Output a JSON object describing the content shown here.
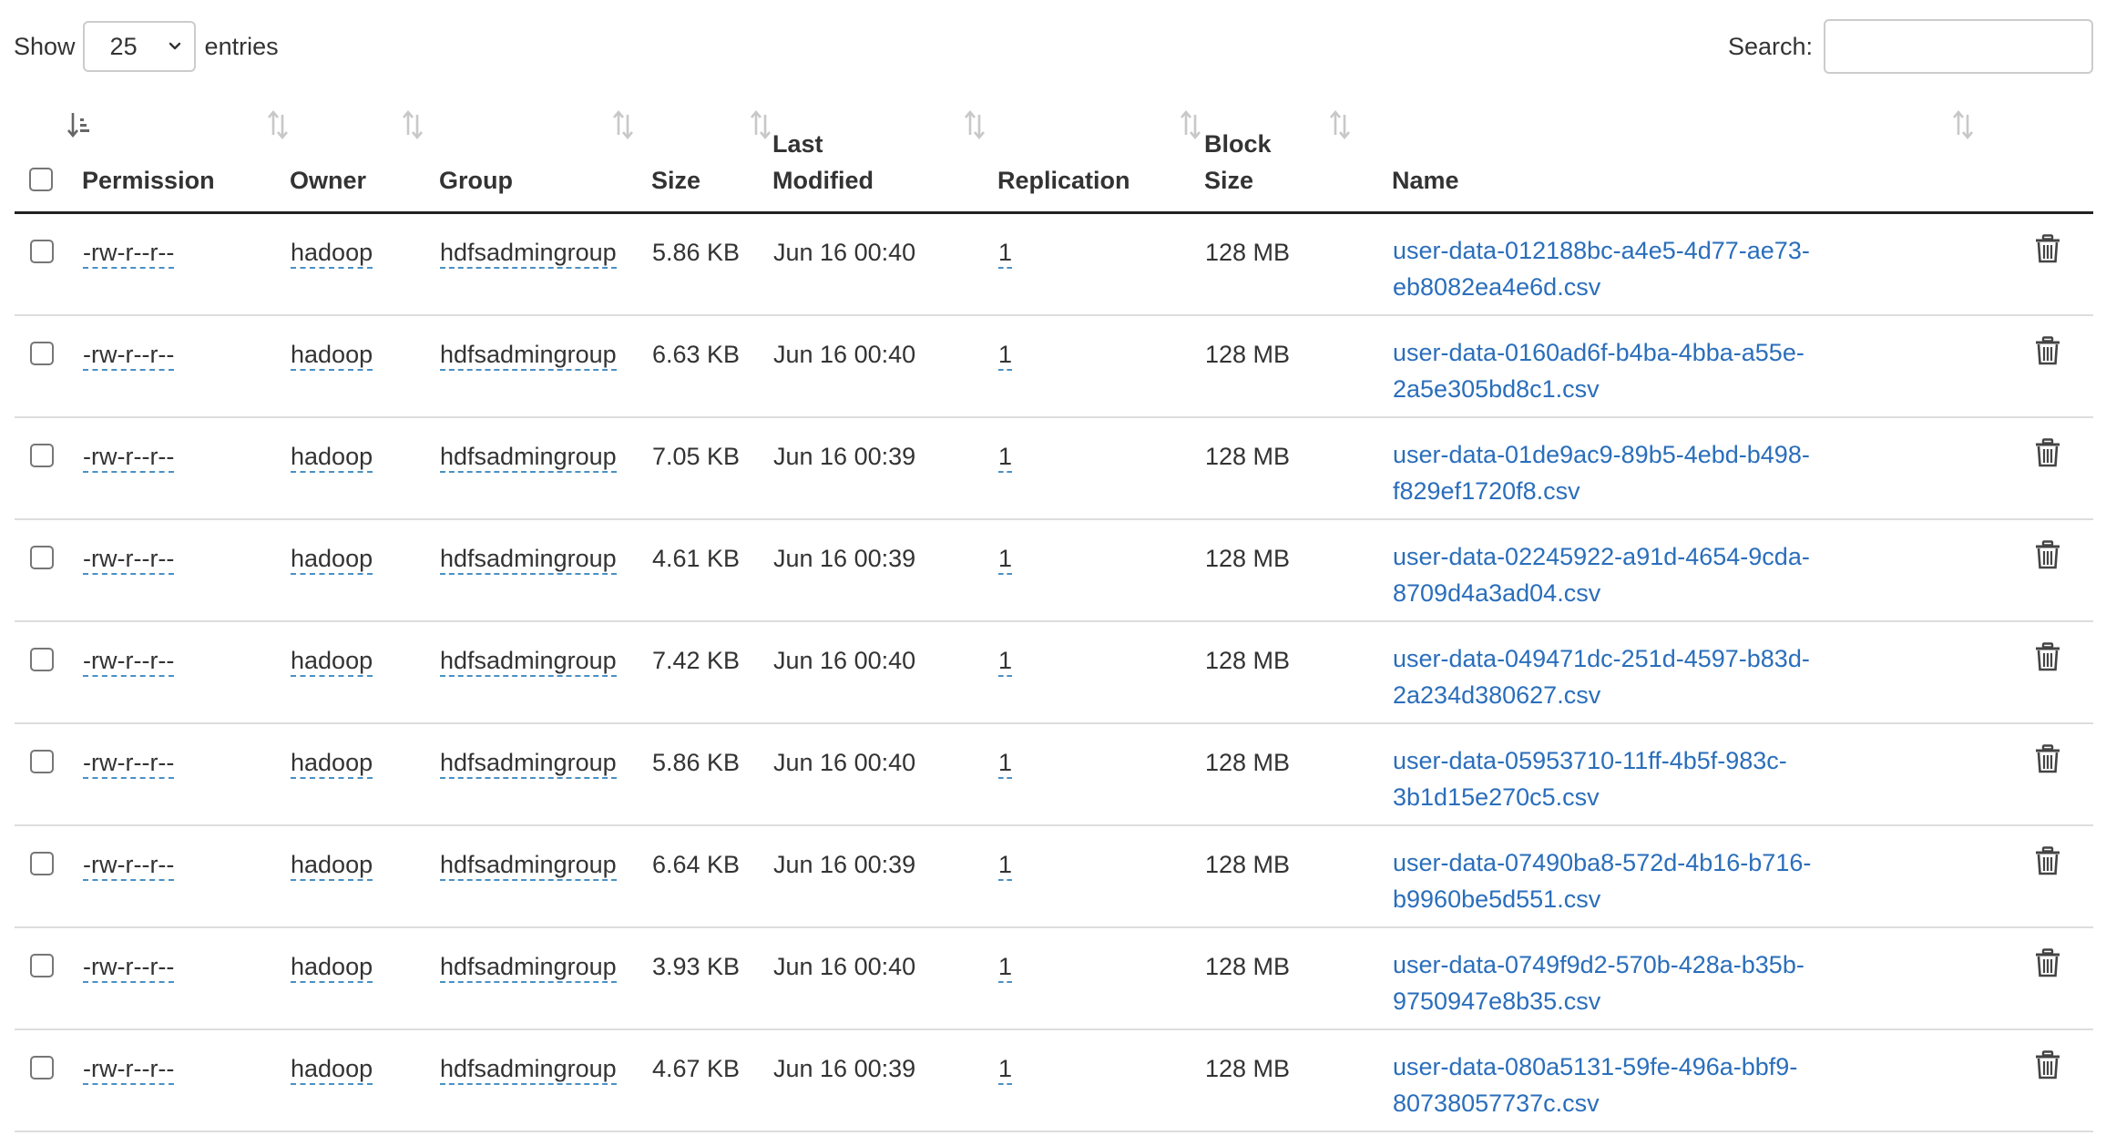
{
  "length_menu": {
    "show_label": "Show",
    "selected": "25",
    "entries_label": "entries"
  },
  "search": {
    "label": "Search:",
    "value": "",
    "placeholder": ""
  },
  "table": {
    "columns": [
      "",
      "Permission",
      "Owner",
      "Group",
      "Size",
      "Last Modified",
      "Replication",
      "Block Size",
      "Name",
      ""
    ],
    "header": {
      "permission": "Permission",
      "owner": "Owner",
      "group": "Group",
      "size": "Size",
      "last_modified_1": "Last",
      "last_modified_2": "Modified",
      "replication": "Replication",
      "block_size_1": "Block",
      "block_size_2": "Size",
      "name": "Name"
    },
    "rows": [
      {
        "permission": "-rw-r--r--",
        "owner": "hadoop",
        "group": "hdfsadmingroup",
        "size": "5.86 KB",
        "modified": "Jun 16 00:40",
        "replication": "1",
        "block_size": "128 MB",
        "name_1": "user-data-012188bc-a4e5-4d77-ae73-",
        "name_2": "eb8082ea4e6d.csv"
      },
      {
        "permission": "-rw-r--r--",
        "owner": "hadoop",
        "group": "hdfsadmingroup",
        "size": "6.63 KB",
        "modified": "Jun 16 00:40",
        "replication": "1",
        "block_size": "128 MB",
        "name_1": "user-data-0160ad6f-b4ba-4bba-a55e-",
        "name_2": "2a5e305bd8c1.csv"
      },
      {
        "permission": "-rw-r--r--",
        "owner": "hadoop",
        "group": "hdfsadmingroup",
        "size": "7.05 KB",
        "modified": "Jun 16 00:39",
        "replication": "1",
        "block_size": "128 MB",
        "name_1": "user-data-01de9ac9-89b5-4ebd-b498-",
        "name_2": "f829ef1720f8.csv"
      },
      {
        "permission": "-rw-r--r--",
        "owner": "hadoop",
        "group": "hdfsadmingroup",
        "size": "4.61 KB",
        "modified": "Jun 16 00:39",
        "replication": "1",
        "block_size": "128 MB",
        "name_1": "user-data-02245922-a91d-4654-9cda-",
        "name_2": "8709d4a3ad04.csv"
      },
      {
        "permission": "-rw-r--r--",
        "owner": "hadoop",
        "group": "hdfsadmingroup",
        "size": "7.42 KB",
        "modified": "Jun 16 00:40",
        "replication": "1",
        "block_size": "128 MB",
        "name_1": "user-data-049471dc-251d-4597-b83d-",
        "name_2": "2a234d380627.csv"
      },
      {
        "permission": "-rw-r--r--",
        "owner": "hadoop",
        "group": "hdfsadmingroup",
        "size": "5.86 KB",
        "modified": "Jun 16 00:40",
        "replication": "1",
        "block_size": "128 MB",
        "name_1": "user-data-05953710-11ff-4b5f-983c-",
        "name_2": "3b1d15e270c5.csv"
      },
      {
        "permission": "-rw-r--r--",
        "owner": "hadoop",
        "group": "hdfsadmingroup",
        "size": "6.64 KB",
        "modified": "Jun 16 00:39",
        "replication": "1",
        "block_size": "128 MB",
        "name_1": "user-data-07490ba8-572d-4b16-b716-",
        "name_2": "b9960be5d551.csv"
      },
      {
        "permission": "-rw-r--r--",
        "owner": "hadoop",
        "group": "hdfsadmingroup",
        "size": "3.93 KB",
        "modified": "Jun 16 00:40",
        "replication": "1",
        "block_size": "128 MB",
        "name_1": "user-data-0749f9d2-570b-428a-b35b-",
        "name_2": "9750947e8b35.csv"
      },
      {
        "permission": "-rw-r--r--",
        "owner": "hadoop",
        "group": "hdfsadmingroup",
        "size": "4.67 KB",
        "modified": "Jun 16 00:39",
        "replication": "1",
        "block_size": "128 MB",
        "name_1": "user-data-080a5131-59fe-496a-bbf9-",
        "name_2": "80738057737c.csv"
      }
    ]
  },
  "colors": {
    "link": "#2a6ebb",
    "dotted_underline": "#4a90c4",
    "text": "#333333",
    "sort_icon": "#c8c8c8",
    "border": "#dddddd"
  },
  "icons": {
    "sort": "sort-icon",
    "sort_active": "sort-ascending-icon",
    "delete": "trash-icon",
    "dropdown": "chevron-down-icon"
  }
}
